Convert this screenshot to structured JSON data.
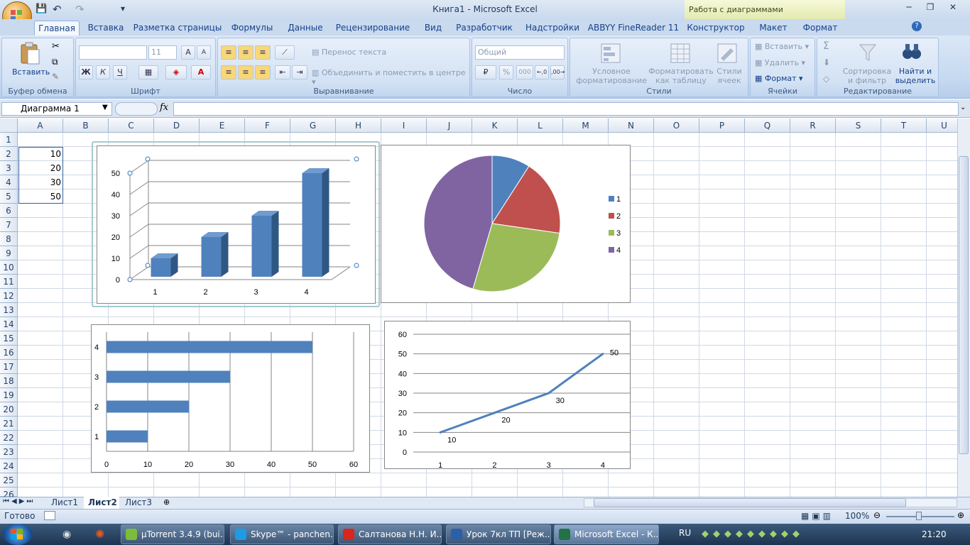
{
  "window": {
    "title": "Книга1 - Microsoft Excel",
    "context_title": "Работа с диаграммами",
    "min": "─",
    "max": "❐",
    "close": "✕"
  },
  "qat": {
    "save": "💾",
    "undo": "↶",
    "redo": "↷",
    "more": "▾"
  },
  "tabs": [
    "Главная",
    "Вставка",
    "Разметка страницы",
    "Формулы",
    "Данные",
    "Рецензирование",
    "Вид",
    "Разработчик",
    "Надстройки",
    "ABBYY FineReader 11",
    "Конструктор",
    "Макет",
    "Формат"
  ],
  "ribbon": {
    "clipboard": {
      "paste": "Вставить",
      "label": "Буфер обмена"
    },
    "font": {
      "name_value": "",
      "size_value": "11",
      "bold": "Ж",
      "italic": "К",
      "underline": "Ч",
      "label": "Шрифт"
    },
    "align": {
      "wrap": "Перенос текста",
      "merge": "Объединить и поместить в центре",
      "label": "Выравнивание"
    },
    "number": {
      "format_value": "Общий",
      "percent": "%",
      "thousands": "000",
      "label": "Число"
    },
    "styles": {
      "conditional": "Условное\nформатирование",
      "as_table": "Форматировать\nкак таблицу",
      "cell_styles": "Стили\nячеек",
      "label": "Стили"
    },
    "cells": {
      "insert": "Вставить",
      "delete": "Удалить",
      "format": "Формат",
      "label": "Ячейки"
    },
    "editing": {
      "sigma": "Σ",
      "sort": "Сортировка\nи фильтр",
      "find": "Найти и\nвыделить",
      "label": "Редактирование"
    }
  },
  "formula_bar": {
    "name_box": "Диаграмма 1",
    "fx": "fx",
    "formula": ""
  },
  "columns": [
    "A",
    "B",
    "C",
    "D",
    "E",
    "F",
    "G",
    "H",
    "I",
    "J",
    "K",
    "L",
    "M",
    "N",
    "O",
    "P",
    "Q",
    "R",
    "S",
    "T",
    "U"
  ],
  "rows": [
    "1",
    "2",
    "3",
    "4",
    "5",
    "6",
    "7",
    "8",
    "9",
    "10",
    "11",
    "12",
    "13",
    "14",
    "15",
    "16",
    "17",
    "18",
    "19",
    "20",
    "21",
    "22",
    "23",
    "24",
    "25",
    "26"
  ],
  "cells": {
    "A2": "10",
    "A3": "20",
    "A4": "30",
    "A5": "50"
  },
  "chart_data": [
    {
      "type": "bar",
      "variant": "3d-column",
      "categories": [
        "1",
        "2",
        "3",
        "4"
      ],
      "values": [
        10,
        20,
        30,
        50
      ],
      "ylim": [
        0,
        50
      ],
      "yticks": [
        "0",
        "10",
        "20",
        "30",
        "40",
        "50"
      ],
      "grid": true
    },
    {
      "type": "pie",
      "categories": [
        "1",
        "2",
        "3",
        "4"
      ],
      "values": [
        10,
        20,
        30,
        50
      ],
      "colors": [
        "#4f81bd",
        "#c0504d",
        "#9bbb59",
        "#8064a2"
      ],
      "legend": "right"
    },
    {
      "type": "bar",
      "variant": "horizontal",
      "categories": [
        "1",
        "2",
        "3",
        "4"
      ],
      "values": [
        10,
        20,
        30,
        50
      ],
      "xlim": [
        0,
        60
      ],
      "xticks": [
        "0",
        "10",
        "20",
        "30",
        "40",
        "50",
        "60"
      ],
      "grid": true
    },
    {
      "type": "line",
      "categories": [
        "1",
        "2",
        "3",
        "4"
      ],
      "values": [
        10,
        20,
        30,
        50
      ],
      "data_labels": [
        "10",
        "20",
        "30",
        "50"
      ],
      "ylim": [
        0,
        60
      ],
      "yticks": [
        "0",
        "10",
        "20",
        "30",
        "40",
        "50",
        "60"
      ],
      "grid": true
    }
  ],
  "sheet_tabs": [
    "Лист1",
    "Лист2",
    "Лист3"
  ],
  "active_sheet": "Лист2",
  "status": {
    "ready": "Готово",
    "zoom": "100%"
  },
  "taskbar": {
    "items": [
      "µTorrent 3.4.9  (bui...",
      "Skype™ - panchen...",
      "Салтанова Н.Н. И...",
      "Урок 7кл ТП [Реж...",
      "Microsoft Excel - К..."
    ],
    "lang": "RU",
    "clock": "21:20"
  },
  "colors": {
    "series": "#4f81bd",
    "accent": "#15428b"
  }
}
